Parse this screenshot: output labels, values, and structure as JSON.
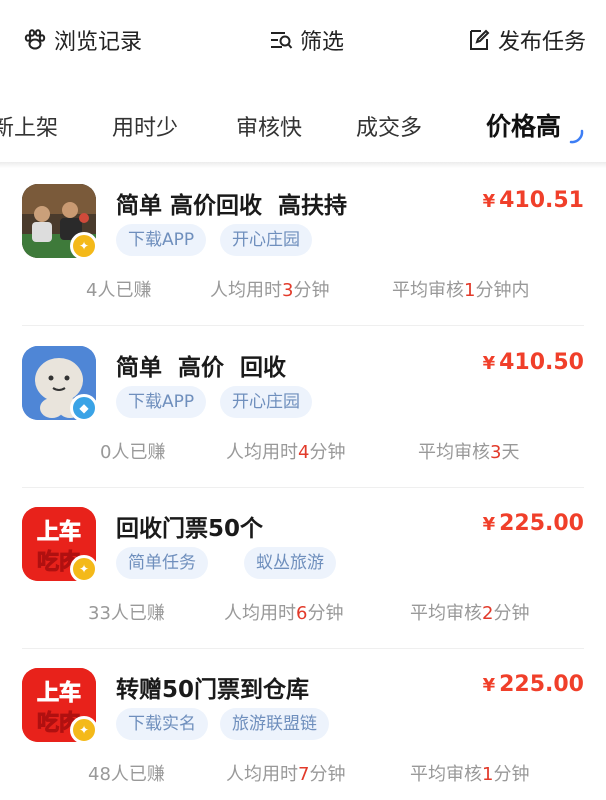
{
  "topbar": {
    "browse": {
      "icon": "paw-icon",
      "label": "浏览记录"
    },
    "filter": {
      "icon": "filter-icon",
      "label": "筛选"
    },
    "publish": {
      "icon": "edit-icon",
      "label": "发布任务"
    }
  },
  "tabs": [
    {
      "label": "新上架",
      "active": false
    },
    {
      "label": "用时少",
      "active": false
    },
    {
      "label": "审核快",
      "active": false
    },
    {
      "label": "成交多",
      "active": false
    },
    {
      "label": "价格高",
      "active": true
    }
  ],
  "colors": {
    "price": "#f03f2a",
    "stat_highlight": "#e23a2a",
    "tag_bg": "#edf3fc",
    "tag_text": "#6f8fbd"
  },
  "tasks": [
    {
      "title": "简单 高价回收  高扶持",
      "currency": "¥",
      "price": "410.51",
      "tags": [
        "下载APP",
        "开心庄园"
      ],
      "earned": {
        "num": "4",
        "text": "人已赚"
      },
      "avg_time": {
        "prefix": "人均用时",
        "num": "3",
        "suffix": "分钟"
      },
      "avg_review": {
        "prefix": "平均审核",
        "num": "1",
        "suffix": "分钟内"
      },
      "avatar": "people-photo",
      "badge": "gold-badge-icon"
    },
    {
      "title": "简单  高价  回收",
      "currency": "¥",
      "price": "410.50",
      "tags": [
        "下载APP",
        "开心庄园"
      ],
      "earned": {
        "num": "0",
        "text": "人已赚"
      },
      "avg_time": {
        "prefix": "人均用时",
        "num": "4",
        "suffix": "分钟"
      },
      "avg_review": {
        "prefix": "平均审核",
        "num": "3",
        "suffix": "天"
      },
      "avatar": "cartoon-character",
      "badge": "diamond-badge-icon"
    },
    {
      "title": "回收门票50个",
      "currency": "¥",
      "price": "225.00",
      "tags": [
        "简单任务",
        "蚁丛旅游"
      ],
      "earned": {
        "num": "33",
        "text": "人已赚"
      },
      "avg_time": {
        "prefix": "人均用时",
        "num": "6",
        "suffix": "分钟"
      },
      "avg_review": {
        "prefix": "平均审核",
        "num": "2",
        "suffix": "分钟"
      },
      "avatar_text": [
        "上车",
        "吃肉"
      ],
      "badge": "gold-badge-icon"
    },
    {
      "title": "转赠50门票到仓库",
      "currency": "¥",
      "price": "225.00",
      "tags": [
        "下载实名",
        "旅游联盟链"
      ],
      "earned": {
        "num": "48",
        "text": "人已赚"
      },
      "avg_time": {
        "prefix": "人均用时",
        "num": "7",
        "suffix": "分钟"
      },
      "avg_review": {
        "prefix": "平均审核",
        "num": "1",
        "suffix": "分钟"
      },
      "avatar_text": [
        "上车",
        "吃肉"
      ],
      "badge": "gold-badge-icon"
    }
  ]
}
